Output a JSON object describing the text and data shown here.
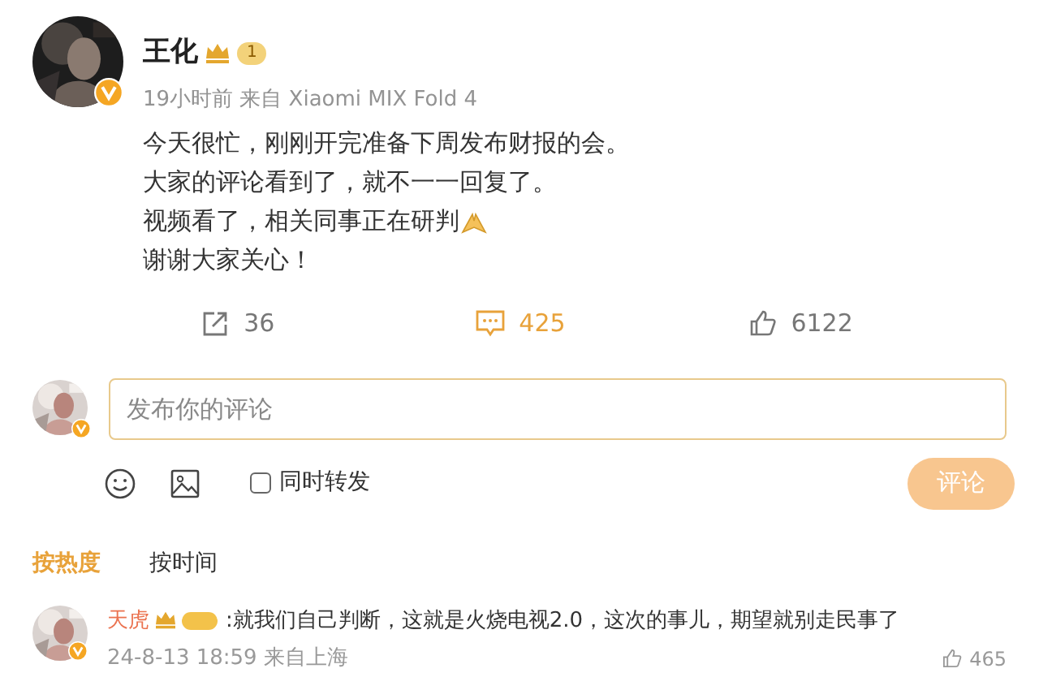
{
  "post": {
    "author": "王化",
    "level_badge": "1",
    "meta": "19小时前 来自 Xiaomi MIX Fold 4",
    "lines": [
      {
        "text": "今天很忙，刚刚开完准备下周发布财报的会。",
        "emoji": false
      },
      {
        "text": "大家的评论看到了，就不一一回复了。",
        "emoji": false
      },
      {
        "text": "视频看了，相关同事正在研判",
        "emoji": true
      },
      {
        "text": "谢谢大家关心！",
        "emoji": false
      }
    ],
    "actions": [
      {
        "kind": "share",
        "count": "36",
        "selected": false
      },
      {
        "kind": "comment",
        "count": "425",
        "selected": true
      },
      {
        "kind": "like",
        "count": "6122",
        "selected": false
      }
    ]
  },
  "composer": {
    "placeholder": "发布你的评论",
    "repost_label": "同时转发",
    "repost_checked": false,
    "submit": "评论"
  },
  "sort_tabs": [
    {
      "label": "按热度",
      "selected": true
    },
    {
      "label": "按时间",
      "selected": false
    }
  ],
  "comments": [
    {
      "author": "天虎",
      "text": ":就我们自己判断，这就是火烧电视2.0，这次的事儿，期望就别走民事了",
      "meta": "24-8-13 18:59 来自上海",
      "like_count": "465"
    }
  ]
}
